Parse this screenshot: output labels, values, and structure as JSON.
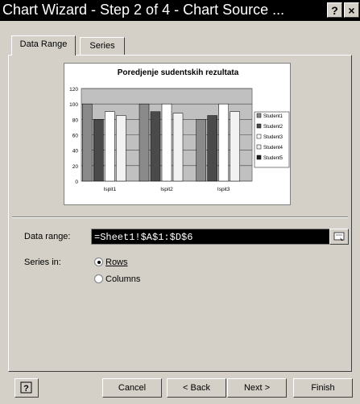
{
  "window": {
    "title": "Chart Wizard - Step 2 of 4 - Chart Source ...",
    "help_label": "?",
    "close_label": "×"
  },
  "tabs": [
    {
      "label": "Data Range",
      "active": true
    },
    {
      "label": "Series",
      "active": false
    }
  ],
  "chart_data": {
    "type": "bar",
    "title": "Poredjenje sudentskih rezultata",
    "categories": [
      "Ispit1",
      "Ispit2",
      "Ispit3"
    ],
    "ylim": [
      0,
      120
    ],
    "yticks": [
      "0",
      "20",
      "40",
      "60",
      "80",
      "100",
      "120"
    ],
    "series": [
      {
        "name": "Student1",
        "values": [
          100,
          100,
          80
        ]
      },
      {
        "name": "Student2",
        "values": [
          80,
          90,
          85
        ]
      },
      {
        "name": "Student3",
        "values": [
          90,
          100,
          100
        ]
      },
      {
        "name": "Student4",
        "values": [
          85,
          88,
          90
        ]
      },
      {
        "name": "Student5",
        "values": [
          0,
          0,
          0
        ]
      }
    ],
    "series_colors": [
      "#8a8a8a",
      "#4a4a4a",
      "#ffffff",
      "#f2f2f2",
      "#1e1e1e"
    ],
    "plot_background": "#c0c0c0",
    "grid": true,
    "legend_position": "right"
  },
  "data_range": {
    "label": "Data range:",
    "value": "=Sheet1!$A$1:$D$6"
  },
  "series_in": {
    "label": "Series in:",
    "options": [
      {
        "label": "Rows",
        "selected": true
      },
      {
        "label": "Columns",
        "selected": false
      }
    ]
  },
  "buttons": {
    "cancel": "Cancel",
    "back": "< Back",
    "next": "Next >",
    "finish": "Finish"
  }
}
